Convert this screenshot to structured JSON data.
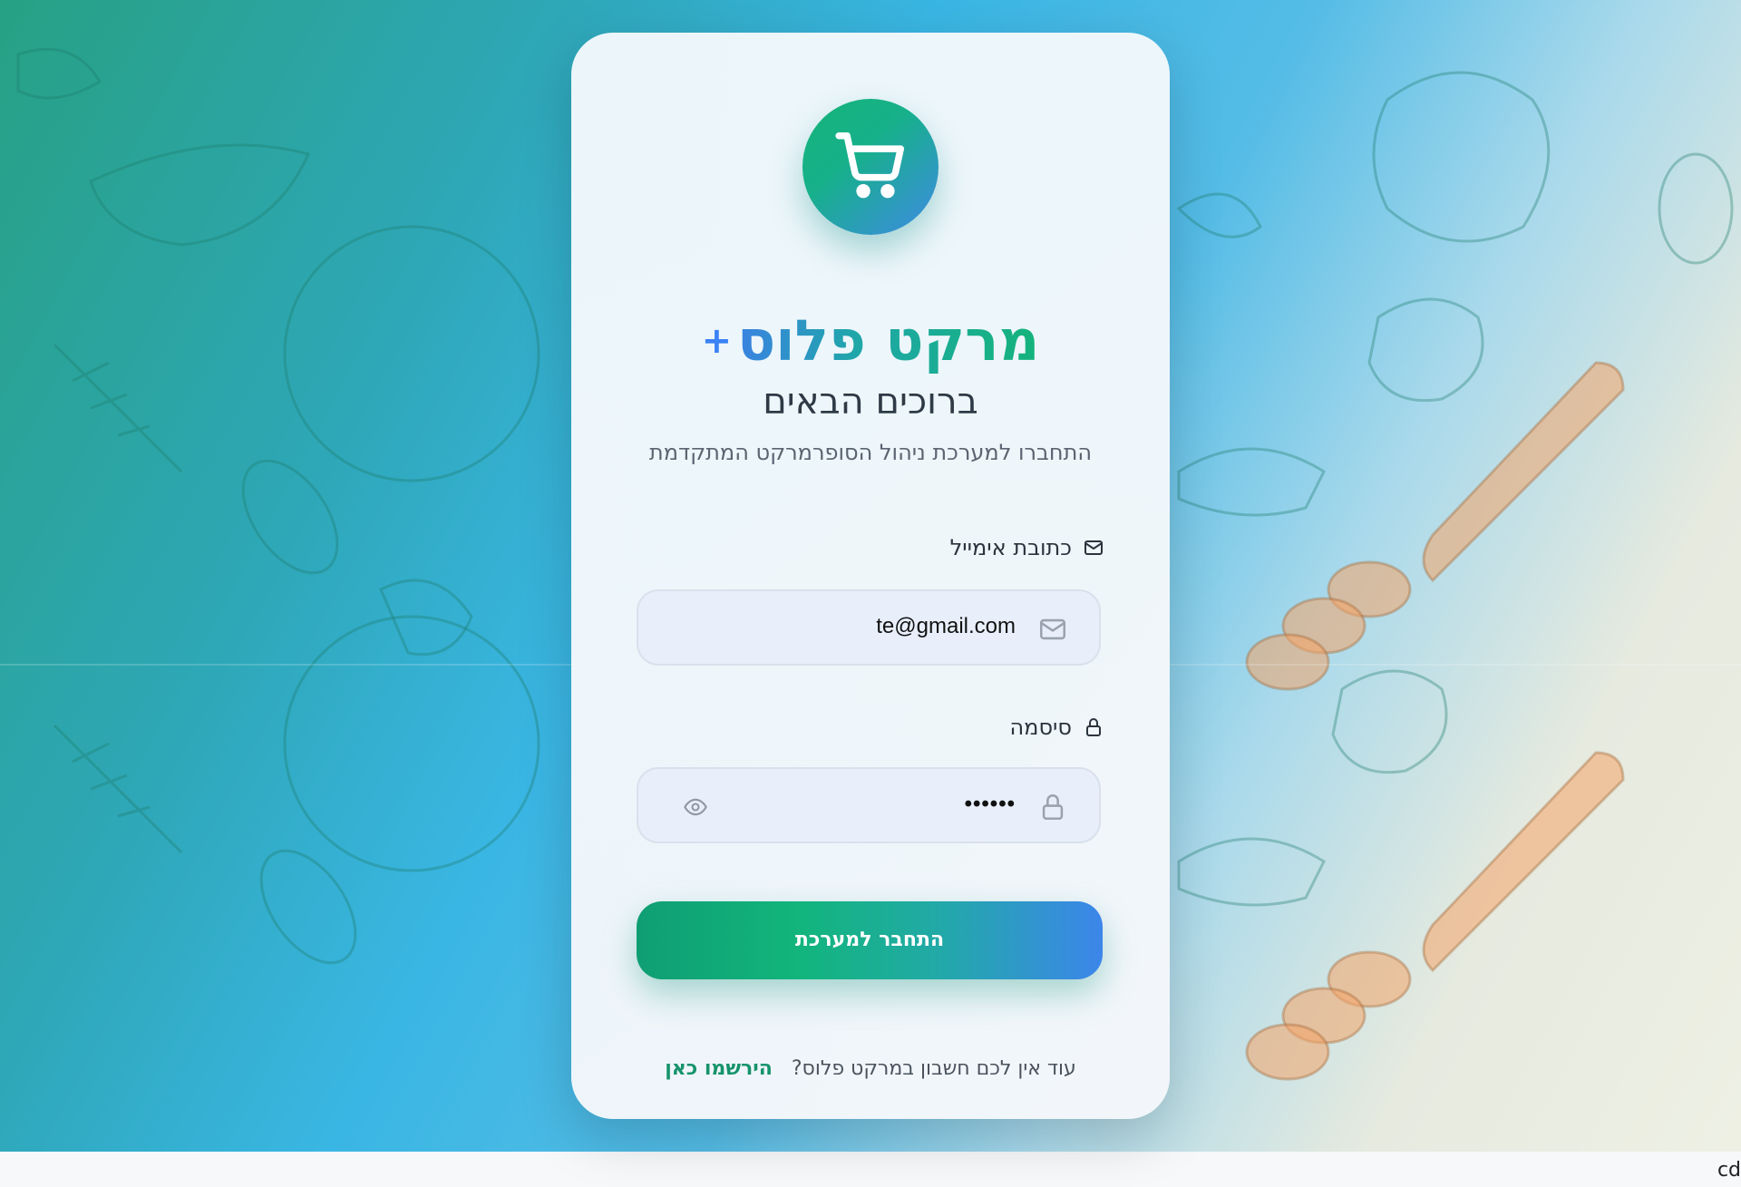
{
  "brand": {
    "name": "מרקט פלוס",
    "plus": "+"
  },
  "welcome": "ברוכים הבאים",
  "subtitle": "התחברו למערכת ניהול הסופרמרקט המתקדמת",
  "email": {
    "label": "כתובת אימייל",
    "value": "te@gmail.com"
  },
  "password": {
    "label": "סיסמה",
    "value": "••••••"
  },
  "submit_label": "התחבר למערכת",
  "signup": {
    "question": "עוד אין לכם חשבון במרקט פלוס?",
    "link": "הירשמו כאן"
  },
  "corner_text": "cd",
  "colors": {
    "accent_green": "#15b478",
    "accent_blue": "#3b82f6",
    "link": "#15936b"
  },
  "icons": [
    "cart-icon",
    "mail-icon",
    "lock-icon",
    "eye-icon"
  ]
}
